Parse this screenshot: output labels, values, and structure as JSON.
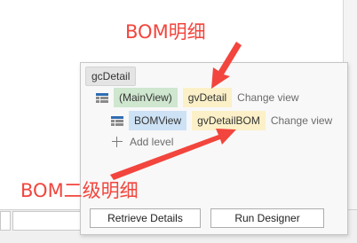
{
  "panel": {
    "title": "gcDetail",
    "rows": [
      {
        "view_label": "(MainView)",
        "view_label_color": "#cfe6cf",
        "grid_name": "gvDetail",
        "action": "Change view"
      },
      {
        "view_label": "BOMView",
        "view_label_color": "#cde2f5",
        "grid_name": "gvDetailBOM",
        "action": "Change view"
      }
    ],
    "add_level_label": "Add level",
    "buttons": {
      "retrieve_details": "Retrieve Details",
      "run_designer": "Run Designer"
    }
  },
  "annotations": {
    "top": "BOM明细",
    "bottom": "BOM二级明细",
    "color": "#f2453d"
  },
  "icons": {
    "grid": "grid-view-icon",
    "add": "plus-icon"
  }
}
